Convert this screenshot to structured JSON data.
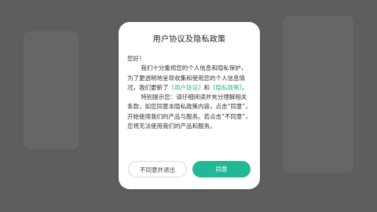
{
  "dialog": {
    "title": "用户协议及隐私政策",
    "greeting": "您好！",
    "para1_a": "我们十分重视您的个人信息和隐私保护，为了更透明地呈现收集和使用您的个人信息情况，我们更新了",
    "user_agreement_link": "《用户协议》",
    "and": "和",
    "privacy_link": "《隐私政策》",
    "para1_end": "。",
    "para2": "特别提示您：请仔细阅读并充分理解相关条款，如您同意本隐私政策内容，点击“同意”，开始使用我们的产品与服务。若点击“不同意”，您将无法使用我们的产品和服务。",
    "decline_label": "不同意并退出",
    "agree_label": "同意"
  },
  "colors": {
    "accent": "#20b896",
    "link": "#2db594",
    "overlay": "#5e5e5e"
  }
}
